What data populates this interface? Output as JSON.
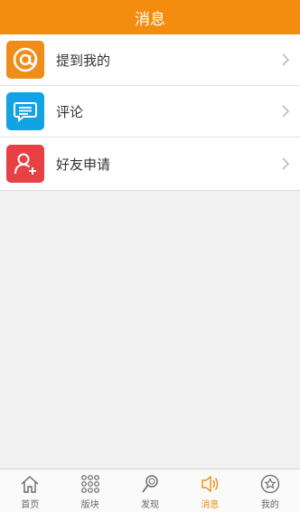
{
  "header": {
    "title": "消息"
  },
  "items": [
    {
      "label": "提到我的",
      "icon": "at-icon",
      "color": "#f08c1a"
    },
    {
      "label": "评论",
      "icon": "comment-icon",
      "color": "#12a3e4"
    },
    {
      "label": "好友申请",
      "icon": "add-friend-icon",
      "color": "#e74146"
    }
  ],
  "tabs": [
    {
      "label": "首页",
      "icon": "home-icon"
    },
    {
      "label": "版块",
      "icon": "grid-icon"
    },
    {
      "label": "发现",
      "icon": "discover-icon"
    },
    {
      "label": "消息",
      "icon": "message-icon",
      "active": true
    },
    {
      "label": "我的",
      "icon": "profile-icon"
    }
  ],
  "colors": {
    "accent": "#f48c10"
  }
}
